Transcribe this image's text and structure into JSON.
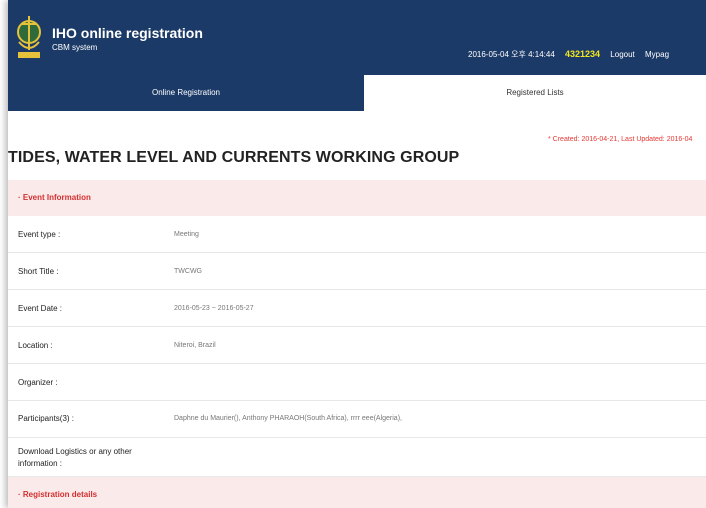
{
  "header": {
    "app_title": "IHO online registration",
    "app_subtitle": "CBM system",
    "datetime": "2016-05-04 오후 4:14:44",
    "user_id": "4321234",
    "logout": "Logout",
    "mypage": "Mypag"
  },
  "tabs": [
    {
      "label": "Online Registration"
    },
    {
      "label": "Registered Lists"
    }
  ],
  "meta": {
    "created_updated": "* Created: 2016-04-21, Last Updated: 2016-04"
  },
  "page_title": "TIDES, WATER LEVEL AND CURRENTS WORKING GROUP",
  "event_section": {
    "heading": "·  Event Information",
    "rows": [
      {
        "label": "Event type :",
        "value": "Meeting"
      },
      {
        "label": "Short Title :",
        "value": "TWCWG"
      },
      {
        "label": "Event Date :",
        "value": "2016-05-23 ~ 2016-05-27"
      },
      {
        "label": "Location :",
        "value": "Niteroi, Brazil"
      },
      {
        "label": "Organizer :",
        "value": ""
      },
      {
        "label": "Participants(3) :",
        "value": "Daphne du Maurier(),   Anthony PHARAOH(South Africa),   rrrr eee(Algeria),"
      },
      {
        "label_line1": "Download Logistics or any other",
        "label_line2": "information :",
        "value": ""
      }
    ]
  },
  "registration_section": {
    "heading": "·  Registration details"
  },
  "colors": {
    "header_bg": "#1c3a67",
    "accent_red": "#d32f2f",
    "user_id_yellow": "#f3e61f",
    "section_bg": "#fbeaea"
  }
}
